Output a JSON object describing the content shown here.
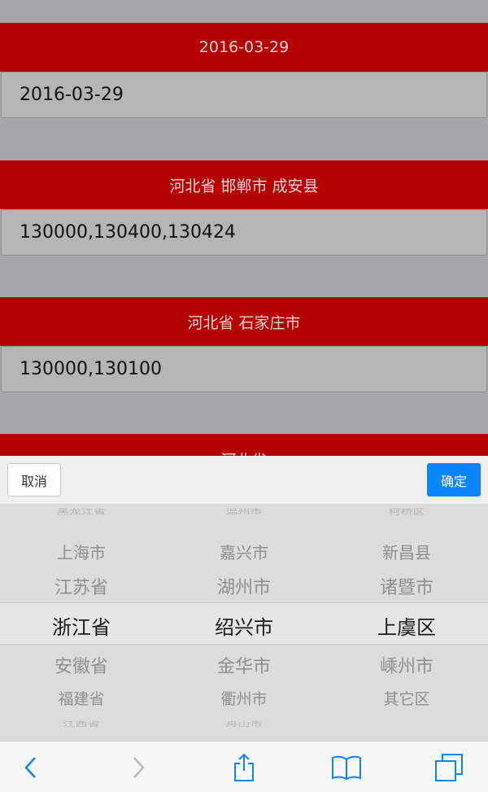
{
  "form": {
    "rows": [
      {
        "header": "2016-03-29",
        "value": "2016-03-29"
      },
      {
        "header": "河北省 邯郸市 成安县",
        "value": "130000,130400,130424"
      },
      {
        "header": "河北省 石家庄市",
        "value": "130000,130100"
      },
      {
        "header": "河北省"
      }
    ]
  },
  "picker": {
    "cancel_label": "取消",
    "confirm_label": "确定",
    "columns": [
      {
        "items": [
          "黑龙江省",
          "上海市",
          "江苏省",
          "浙江省",
          "安徽省",
          "福建省",
          "江西省"
        ],
        "selected": "浙江省"
      },
      {
        "items": [
          "温州市",
          "嘉兴市",
          "湖州市",
          "绍兴市",
          "金华市",
          "衢州市",
          "舟山市"
        ],
        "selected": "绍兴市"
      },
      {
        "items": [
          "柯桥区",
          "新昌县",
          "诸暨市",
          "上虞区",
          "嵊州市",
          "其它区"
        ],
        "selected": "上虞区"
      }
    ]
  },
  "toolbar": {
    "icons": [
      "back-icon",
      "forward-icon",
      "share-icon",
      "bookmarks-icon",
      "tabs-icon"
    ],
    "accent": "#0a84ff"
  },
  "colors": {
    "header_red": "#b40000",
    "confirm_blue": "#0a84ff"
  }
}
